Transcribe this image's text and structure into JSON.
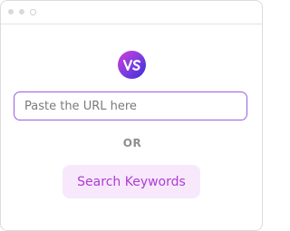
{
  "window": {
    "controls": [
      "dot",
      "dot",
      "dot"
    ]
  },
  "logo": {
    "text": "VS",
    "icon": "vs-logo-icon",
    "gradient": [
      "#d63bd9",
      "#7a3de0",
      "#3d2bd6"
    ]
  },
  "url_input": {
    "value": "",
    "placeholder": "Paste the URL here",
    "border_color": "#9b5de5"
  },
  "divider": {
    "label": "OR"
  },
  "search_button": {
    "label": "Search Keywords",
    "background": "#f7e9fb",
    "text_color": "#b03ad6"
  }
}
